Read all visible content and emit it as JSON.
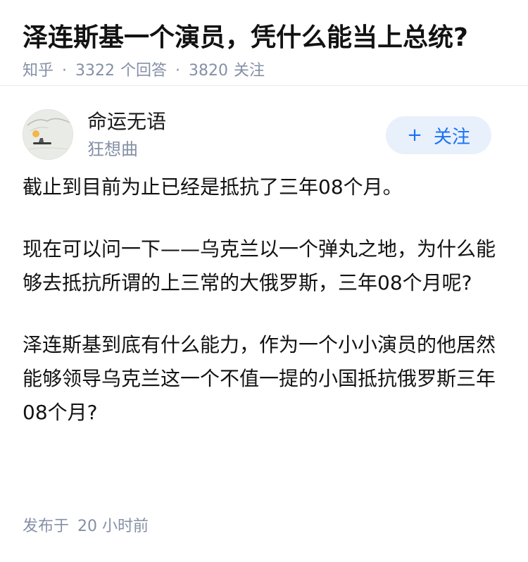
{
  "question": {
    "title": "泽连斯基一个演员，凭什么能当上总统?",
    "source": "知乎",
    "answers_count": "3322",
    "answers_label": "个回答",
    "follow_count": "3820",
    "follow_label": "关注"
  },
  "author": {
    "name": "命运无语",
    "subtitle": "狂想曲",
    "follow_button": "关注",
    "follow_icon": "plus-icon"
  },
  "answer": {
    "paragraphs": [
      "截止到目前为止已经是抵抗了三年08个月。",
      "现在可以问一下——乌克兰以一个弹丸之地，为什么能够去抵抗所谓的上三常的大俄罗斯，三年08个月呢?",
      "泽连斯基到底有什么能力，作为一个小小演员的他居然能够领导乌克兰这一个不值一提的小国抵抗俄罗斯三年08个月?"
    ],
    "published_label": "发布于",
    "published_time": "20 小时前"
  },
  "colors": {
    "accent": "#1772f6",
    "meta_gray": "#8590a6",
    "follow_bg": "#e8f0fb"
  }
}
